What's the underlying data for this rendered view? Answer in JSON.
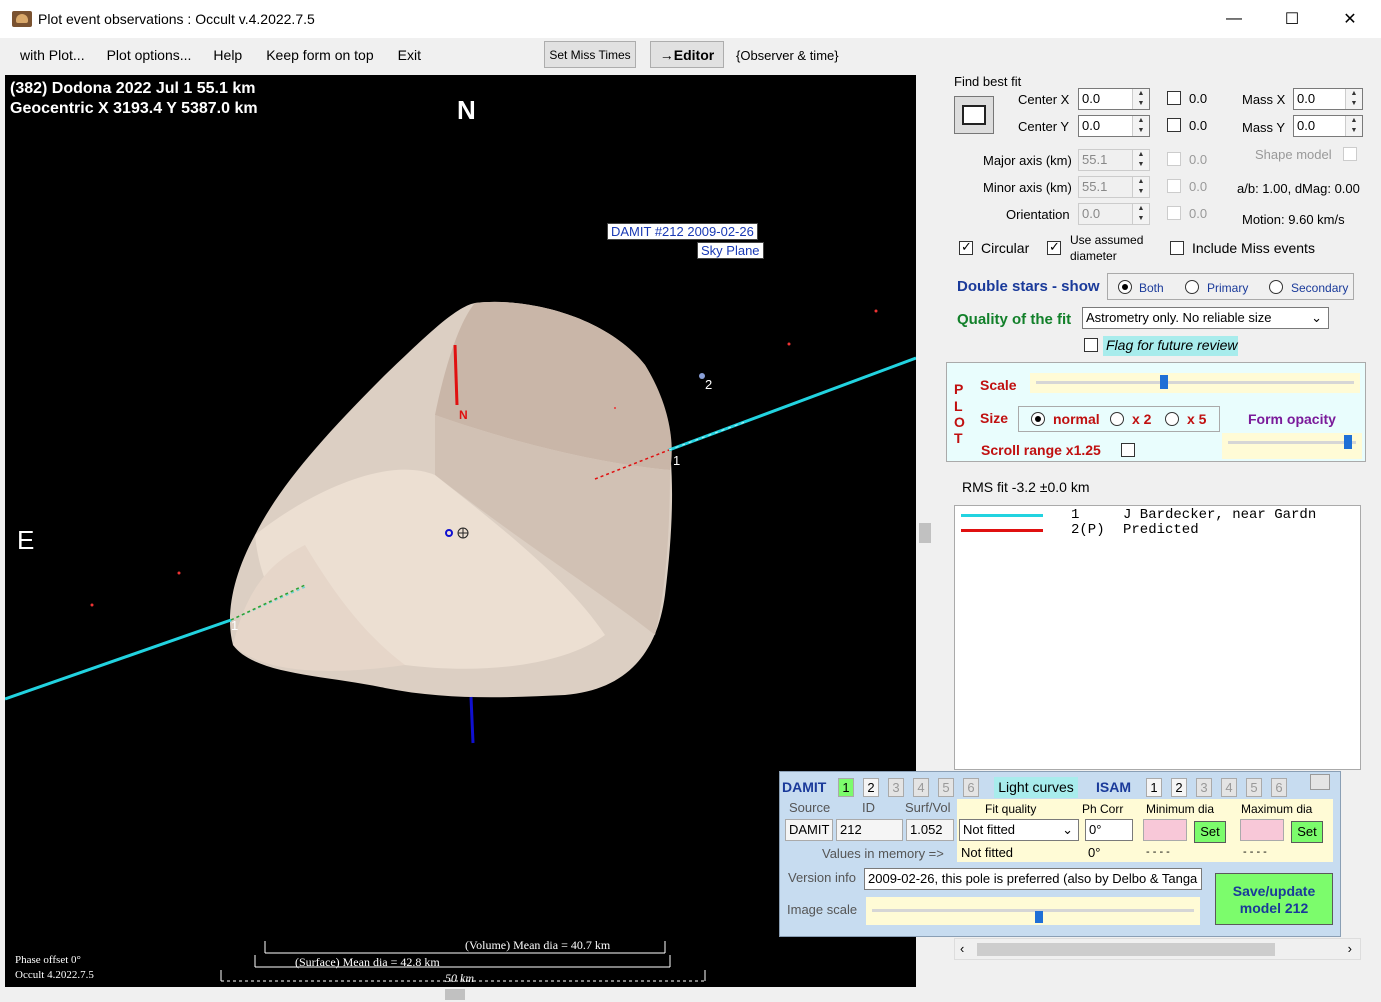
{
  "window": {
    "title": "Plot event observations : Occult v.4.2022.7.5",
    "minimize": "—",
    "maximize": "☐",
    "close": "✕"
  },
  "menu": {
    "items": [
      "with Plot...",
      "Plot options...",
      "Help",
      "Keep form on top",
      "Exit"
    ],
    "set_miss_times": "Set Miss Times",
    "editor": "→Editor",
    "observer_time": "{Observer & time}"
  },
  "plot": {
    "header_line1": "(382) Dodona  2022 Jul 1   55.1 km",
    "header_line2": "Geocentric  X  3193.4  Y 5387.0 km",
    "north": "N",
    "east": "E",
    "damit_label": "DAMIT #212 2009-02-26",
    "sky_plane": "Sky Plane",
    "chord1_label": "1",
    "chord1b_label": "1",
    "star2_label": "2",
    "pole_n_label": "N",
    "phase_offset": "Phase offset 0°",
    "occult_version": "Occult 4.2022.7.5",
    "volume_dia": "(Volume) Mean dia = 40.7 km",
    "surface_dia": "(Surface) Mean dia = 42.8 km",
    "scale_km": "50 km"
  },
  "fit": {
    "find_best_fit": "Find best fit",
    "center_x_label": "Center X",
    "center_x": "0.0",
    "center_x_step": "0.0",
    "center_y_label": "Center Y",
    "center_y": "0.0",
    "center_y_step": "0.0",
    "mass_x_label": "Mass X",
    "mass_x": "0.0",
    "mass_y_label": "Mass Y",
    "mass_y": "0.0",
    "major_label": "Major axis (km)",
    "major": "55.1",
    "major_step": "0.0",
    "minor_label": "Minor axis (km)",
    "minor": "55.1",
    "minor_step": "0.0",
    "orient_label": "Orientation",
    "orient": "0.0",
    "orient_step": "0.0",
    "shape_model": "Shape model",
    "ab": "a/b: 1.00, dMag: 0.00",
    "motion": "Motion: 9.60 km/s",
    "circular": "Circular",
    "use_assumed": "Use assumed",
    "diameter": "diameter",
    "include_miss": "Include Miss events",
    "double_stars": "Double stars - show",
    "both": "Both",
    "primary": "Primary",
    "secondary": "Secondary",
    "quality_label": "Quality of the fit",
    "quality_value": "Astrometry only. No reliable size",
    "flag_review": "Flag for future review"
  },
  "plotctl": {
    "plot_letters": [
      "P",
      "L",
      "O",
      "T"
    ],
    "scale": "Scale",
    "size": "Size",
    "normal": "normal",
    "x2": "x 2",
    "x5": "x 5",
    "form_opacity": "Form opacity",
    "scroll_range": "Scroll range x1.25",
    "scale_level": 0.4,
    "opacity_level": 0.97
  },
  "rms": "RMS fit -3.2 ±0.0 km",
  "legend": [
    {
      "color": "#22d3e0",
      "num": "1",
      "text": "J Bardecker, near Gardn"
    },
    {
      "color": "#e01010",
      "num": "2(P)",
      "text": "Predicted"
    }
  ],
  "damit": {
    "damit": "DAMIT",
    "damit_nums": [
      "1",
      "2",
      "3",
      "4",
      "5",
      "6"
    ],
    "light_curves": "Light curves",
    "isam": "ISAM",
    "isam_nums": [
      "1",
      "2",
      "3",
      "4",
      "5",
      "6"
    ],
    "source_h": "Source",
    "id_h": "ID",
    "surfvol_h": "Surf/Vol",
    "source": "DAMIT",
    "id": "212",
    "surfvol": "1.052",
    "fit_quality_h": "Fit quality",
    "ph_corr_h": "Ph Corr",
    "min_dia_h": "Minimum dia",
    "max_dia_h": "Maximum dia",
    "fit_quality": "Not fitted",
    "ph_corr": "0°",
    "set": "Set",
    "values_mem": "Values in memory =>",
    "mem_fit": "Not fitted",
    "mem_ph": "0°",
    "mem_min": "- - - -",
    "mem_max": "- - - -",
    "version_label": "Version info",
    "version": "2009-02-26, this pole is preferred (also by Delbo & Tanga",
    "image_scale": "Image scale",
    "image_scale_level": 0.52,
    "save": "Save/update",
    "model": "model 212"
  }
}
